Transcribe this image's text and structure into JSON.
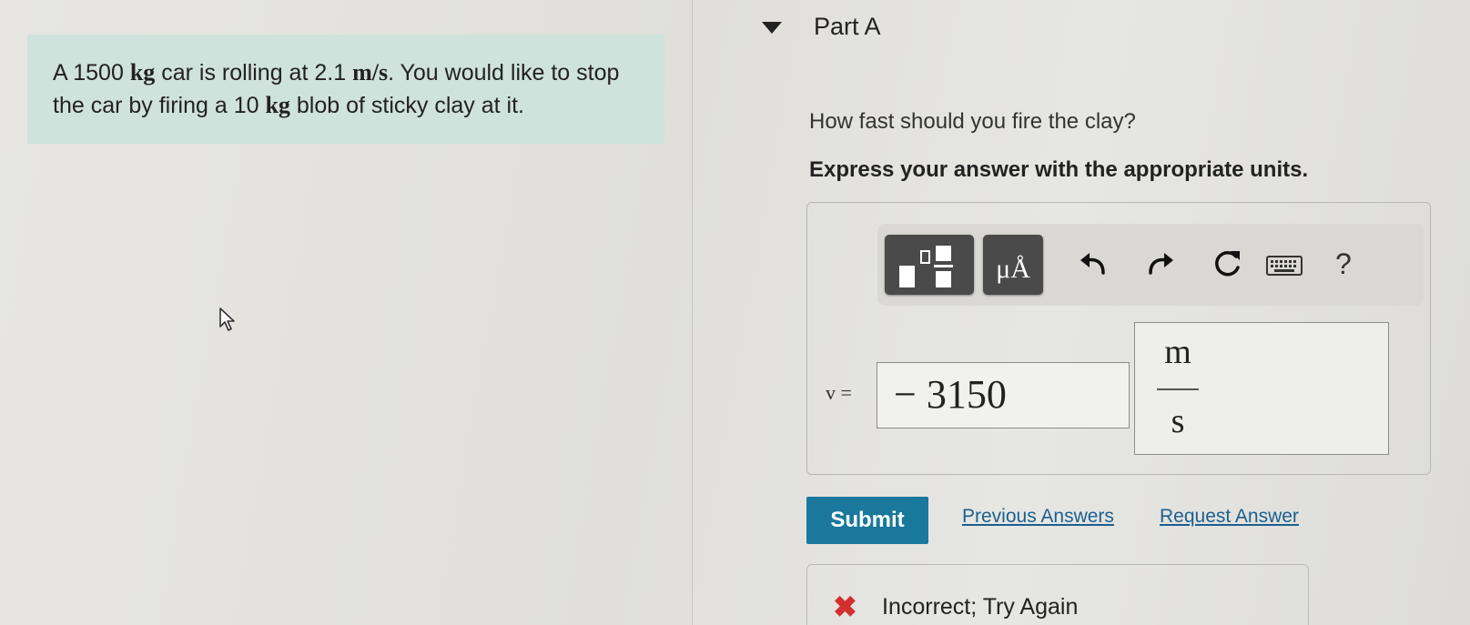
{
  "problem": {
    "intro": "A 1500",
    "unit1": "kg",
    "mid1": "car is rolling at 2.1",
    "unit2": "m/s",
    "mid2": ". You would like to stop the car by firing a 10",
    "unit3": "kg",
    "end": "blob of sticky clay at it."
  },
  "part": {
    "title": "Part A",
    "question": "How fast should you fire the clay?",
    "instructions": "Express your answer with the appropriate units."
  },
  "toolbar": {
    "templates_icon": "templates-icon",
    "units_label": "μÅ",
    "undo_icon": "undo-icon",
    "redo_icon": "redo-icon",
    "reset_icon": "reset-icon",
    "keyboard_icon": "keyboard-icon",
    "help_label": "?"
  },
  "answer": {
    "variable": "v =",
    "value": "− 3150",
    "unit_numerator": "m",
    "unit_denominator": "s"
  },
  "actions": {
    "submit_label": "Submit",
    "previous_answers": "Previous Answers",
    "request_answer": "Request Answer"
  },
  "feedback": {
    "text": "Incorrect; Try Again",
    "color": "#d22f2f"
  },
  "colors": {
    "problem_bg": "#cfe2dc",
    "submit_bg": "#19789c",
    "link": "#1d5f8f"
  }
}
